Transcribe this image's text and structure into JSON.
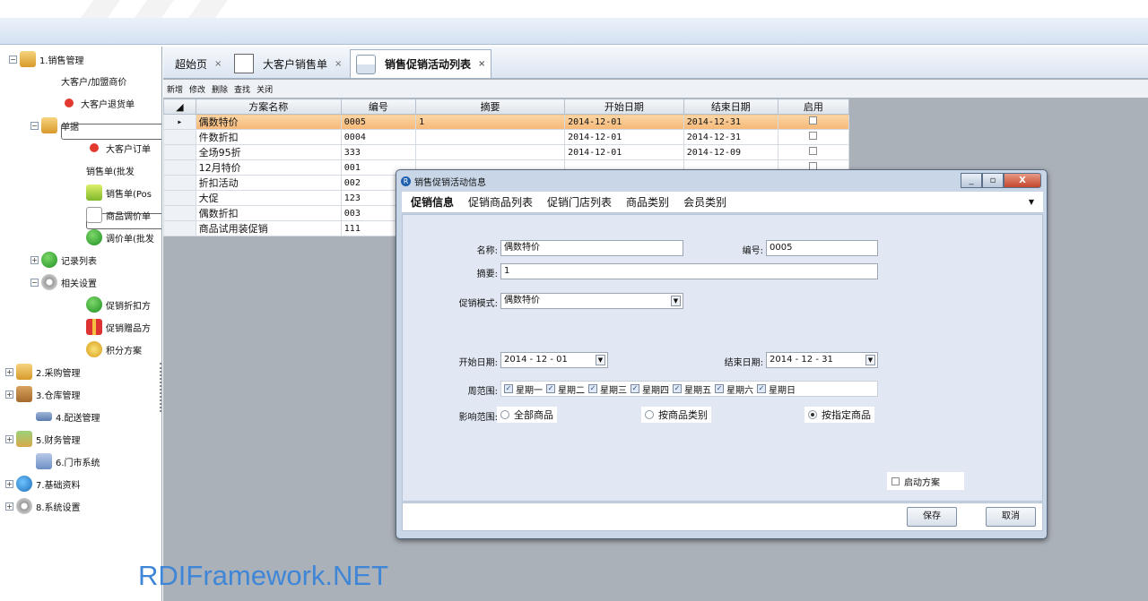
{
  "tree": [
    {
      "label": "1.销售管理",
      "icon": "folder-icon"
    },
    {
      "label": "大客户/加盟商价",
      "icon": "grid-icon"
    },
    {
      "label": "大客户退货单",
      "icon": "red-dot-icon"
    },
    {
      "label": "单据",
      "icon": "folder-icon"
    },
    {
      "label": "大客户订单",
      "icon": "red-dot-icon"
    },
    {
      "label": "销售单(批发",
      "icon": "grid-icon"
    },
    {
      "label": "销售单(Pos",
      "icon": "yuan-icon"
    },
    {
      "label": "商品调价单",
      "icon": "document-icon"
    },
    {
      "label": "调价单(批发",
      "icon": "arrow-right-icon"
    },
    {
      "label": "记录列表",
      "icon": "arrow-right-icon"
    },
    {
      "label": "相关设置",
      "icon": "gear-icon"
    },
    {
      "label": "促销折扣方",
      "icon": "arrow-right-icon"
    },
    {
      "label": "促销赠品方",
      "icon": "gift-icon"
    },
    {
      "label": "积分方案",
      "icon": "medal-icon"
    },
    {
      "label": "2.采购管理",
      "icon": "calendar-icon"
    },
    {
      "label": "3.仓库管理",
      "icon": "box-icon"
    },
    {
      "label": "4.配送管理",
      "icon": "truck-icon"
    },
    {
      "label": "5.财务管理",
      "icon": "money-icon"
    },
    {
      "label": "6.门市系统",
      "icon": "network-icon"
    },
    {
      "label": "7.基础资料",
      "icon": "globe-icon"
    },
    {
      "label": "8.系统设置",
      "icon": "gear-icon"
    }
  ],
  "tabs": {
    "home": "超始页",
    "orders": "大客户销售单",
    "promo": "销售促销活动列表",
    "close": "×"
  },
  "toolbar": [
    "新增",
    "修改",
    "删除",
    "查找",
    "关闭"
  ],
  "grid": {
    "columns": [
      "方案名称",
      "编号",
      "摘要",
      "开始日期",
      "结束日期",
      "启用"
    ],
    "rows": [
      {
        "name": "偶数特价",
        "code": "0005",
        "summary": "1",
        "start": "2014-12-01",
        "end": "2014-12-31",
        "selected": true
      },
      {
        "name": "件数折扣",
        "code": "0004",
        "summary": "",
        "start": "2014-12-01",
        "end": "2014-12-31",
        "selected": false
      },
      {
        "name": "全场95折",
        "code": "333",
        "summary": "",
        "start": "2014-12-01",
        "end": "2014-12-09",
        "selected": false
      },
      {
        "name": "12月特价",
        "code": "001",
        "summary": "",
        "start": "",
        "end": "",
        "selected": false
      },
      {
        "name": "折扣活动",
        "code": "002",
        "summary": "",
        "start": "",
        "end": "",
        "selected": false
      },
      {
        "name": "大促",
        "code": "123",
        "summary": "",
        "start": "",
        "end": "",
        "selected": false
      },
      {
        "name": "偶数折扣",
        "code": "003",
        "summary": "",
        "start": "",
        "end": "",
        "selected": false
      },
      {
        "name": "商品试用装促销",
        "code": "111",
        "summary": "",
        "start": "",
        "end": "",
        "selected": false
      }
    ]
  },
  "dialog": {
    "title": "销售促销活动信息",
    "app_icon": "R",
    "tabs": [
      "促销信息",
      "促销商品列表",
      "促销门店列表",
      "商品类别",
      "会员类别"
    ],
    "form": {
      "name_label": "名称:",
      "name_value": "偶数特价",
      "code_label": "编号:",
      "code_value": "0005",
      "summary_label": "摘要:",
      "summary_value": "1",
      "mode_label": "促销模式:",
      "mode_value": "偶数特价",
      "start_label": "开始日期:",
      "start_value": "2014 - 12 - 01",
      "end_label": "结束日期:",
      "end_value": "2014 - 12 - 31",
      "week_label": "周范围:",
      "weekdays": [
        "星期一",
        "星期二",
        "星期三",
        "星期四",
        "星期五",
        "星期六",
        "星期日"
      ],
      "scope_label": "影响范围:",
      "scope_options": [
        "全部商品",
        "按商品类别",
        "按指定商品"
      ],
      "scope_selected": 2,
      "enable_label": "启动方案"
    },
    "save": "保存",
    "cancel": "取消"
  },
  "watermark": "RDIFramework.NET"
}
